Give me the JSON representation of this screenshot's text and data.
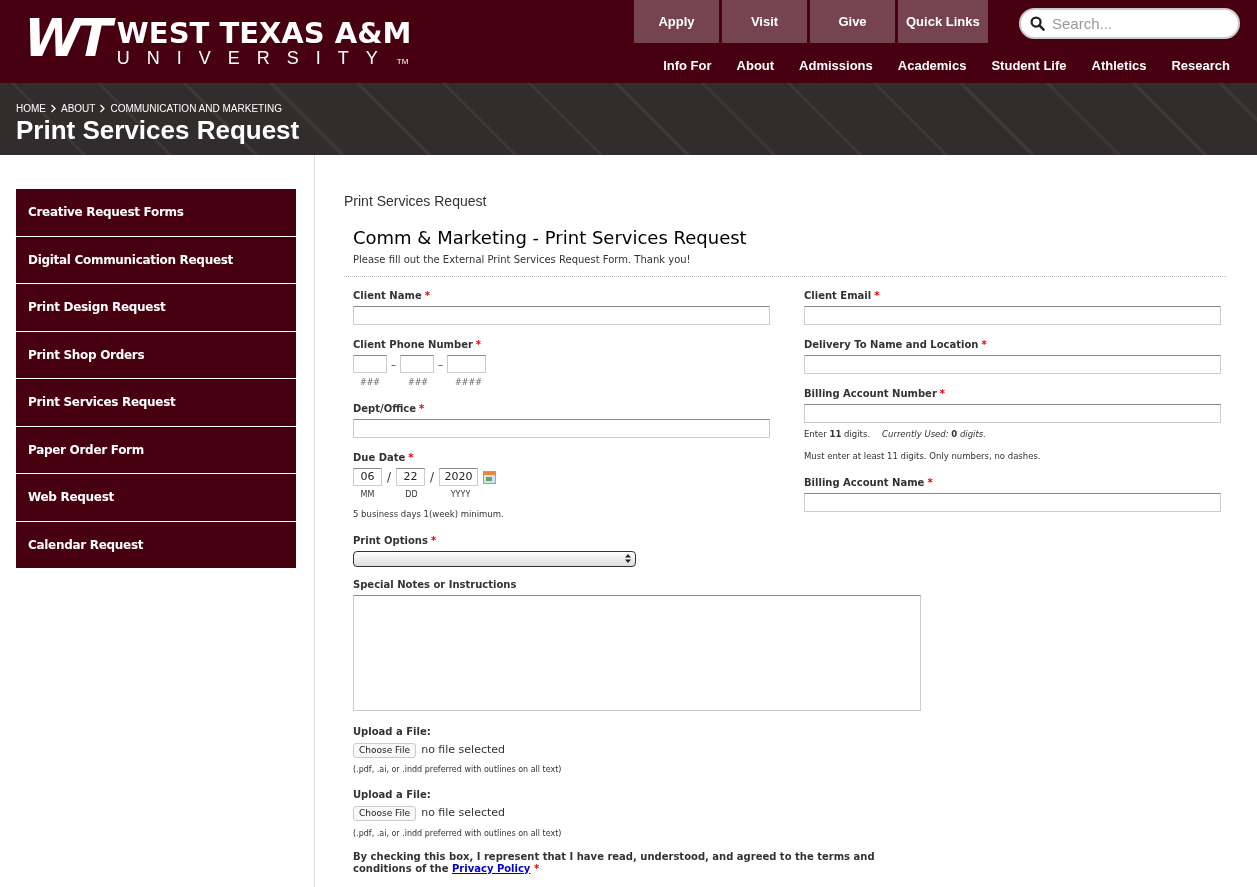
{
  "header": {
    "logo": {
      "mark": "WT",
      "name": "WEST TEXAS A&M",
      "sub": "UNIVERSITY",
      "tm": "TM"
    },
    "utility_buttons": [
      "Apply",
      "Visit",
      "Give",
      "Quick Links"
    ],
    "search": {
      "placeholder": "Search..."
    },
    "nav": [
      "Info For",
      "About",
      "Admissions",
      "Academics",
      "Student Life",
      "Athletics",
      "Research"
    ]
  },
  "banner": {
    "breadcrumb": [
      "HOME",
      "ABOUT",
      "COMMUNICATION AND MARKETING"
    ],
    "title": "Print Services Request"
  },
  "sidebar": {
    "items": [
      "Creative Request Forms",
      "Digital Communication Request",
      "Print Design Request",
      "Print Shop Orders",
      "Print Services Request",
      "Paper Order Form",
      "Web Request",
      "Calendar Request"
    ]
  },
  "page_label": "Print Services Request",
  "form": {
    "required_mark": "*",
    "title": "Comm & Marketing - Print Services Request",
    "intro": "Please fill out the External Print Services Request Form. Thank you!",
    "left": [
      {
        "kind": "text",
        "label": "Client Name",
        "required": true
      },
      {
        "kind": "phone",
        "label": "Client Phone Number",
        "required": true,
        "separator": "–",
        "hints": [
          "###",
          "###",
          "####"
        ]
      },
      {
        "kind": "text",
        "label": "Dept/Office",
        "required": true
      },
      {
        "kind": "date",
        "label": "Due Date",
        "required": true,
        "separator": "/",
        "values": [
          "06",
          "22",
          "2020"
        ],
        "hints": [
          "MM",
          "DD",
          "YYYY"
        ],
        "note": "5 business days 1(week) minimum."
      }
    ],
    "right": [
      {
        "kind": "text",
        "label": "Client Email",
        "required": true
      },
      {
        "kind": "text",
        "label": "Delivery To Name and Location",
        "required": true
      },
      {
        "kind": "text",
        "label": "Billing Account Number",
        "required": true,
        "help": [
          "Enter **11** digits.",
          "*Currently Used:* **0** *digits.*"
        ],
        "note": "Must enter at least 11 digits. Only numbers, no dashes."
      },
      {
        "kind": "text",
        "label": "Billing Account Name",
        "required": true
      }
    ],
    "bottom": [
      {
        "kind": "select",
        "label": "Print Options",
        "required": true
      },
      {
        "kind": "textarea",
        "label": "Special Notes or Instructions",
        "required": false
      },
      {
        "kind": "file",
        "label": "Upload a File:",
        "required": false,
        "button": "Choose File",
        "status": "no file selected",
        "note": "(.pdf, .ai, or .indd preferred with outlines on all text)"
      },
      {
        "kind": "file",
        "label": "Upload a File:",
        "required": false,
        "button": "Choose File",
        "status": "no file selected",
        "note": "(.pdf, .ai, or .indd preferred with outlines on all text)"
      },
      {
        "kind": "consent",
        "text": "By checking this box, I represent that I have read, understood, and agreed to the terms and conditions of the",
        "link": "Privacy Policy",
        "required": true
      }
    ]
  }
}
